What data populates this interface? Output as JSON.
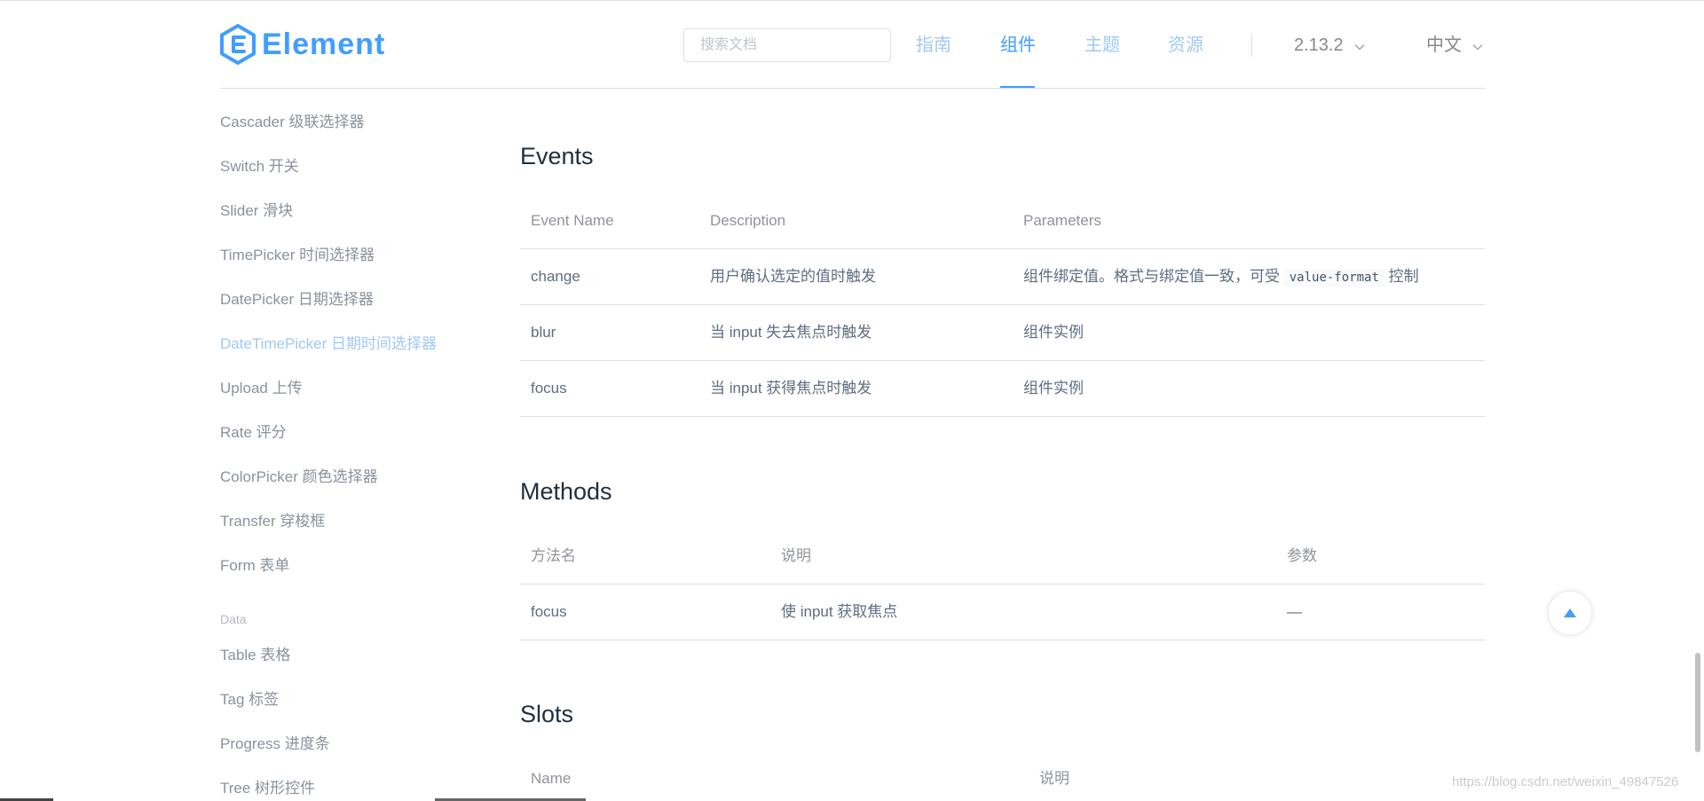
{
  "header": {
    "logo_text": "Element",
    "search_placeholder": "搜索文档",
    "nav": [
      {
        "label": "指南",
        "active": false
      },
      {
        "label": "组件",
        "active": true
      },
      {
        "label": "主题",
        "active": false
      },
      {
        "label": "资源",
        "active": false
      }
    ],
    "version": "2.13.2",
    "language": "中文"
  },
  "sidebar": {
    "items": [
      {
        "label": "Cascader 级联选择器"
      },
      {
        "label": "Switch 开关"
      },
      {
        "label": "Slider 滑块"
      },
      {
        "label": "TimePicker 时间选择器"
      },
      {
        "label": "DatePicker 日期选择器"
      },
      {
        "label": "DateTimePicker 日期时间选择器",
        "active": true
      },
      {
        "label": "Upload 上传"
      },
      {
        "label": "Rate 评分"
      },
      {
        "label": "ColorPicker 颜色选择器"
      },
      {
        "label": "Transfer 穿梭框"
      },
      {
        "label": "Form 表单"
      }
    ],
    "group_label": "Data",
    "group_items": [
      {
        "label": "Table 表格"
      },
      {
        "label": "Tag 标签"
      },
      {
        "label": "Progress 进度条"
      },
      {
        "label": "Tree 树形控件"
      }
    ]
  },
  "events": {
    "title": "Events",
    "headers": [
      "Event Name",
      "Description",
      "Parameters"
    ],
    "rows": [
      {
        "name": "change",
        "desc": "用户确认选定的值时触发",
        "params_pre": "组件绑定值。格式与绑定值一致，可受",
        "params_code": "value-format",
        "params_post": "控制"
      },
      {
        "name": "blur",
        "desc": "当 input 失去焦点时触发",
        "params_pre": "组件实例"
      },
      {
        "name": "focus",
        "desc": "当 input 获得焦点时触发",
        "params_pre": "组件实例"
      }
    ]
  },
  "methods": {
    "title": "Methods",
    "headers": [
      "方法名",
      "说明",
      "参数"
    ],
    "rows": [
      {
        "name": "focus",
        "desc": "使 input 获取焦点",
        "params": "—"
      }
    ]
  },
  "slots": {
    "title": "Slots",
    "headers": [
      "Name",
      "说明"
    ]
  },
  "watermark": "https://blog.csdn.net/weixin_49847526",
  "colors": {
    "accent": "#409eff",
    "accent_light": "#9fc9f3",
    "text": "#5e6d82",
    "heading": "#1f2f3d",
    "border": "#dcdfe6"
  },
  "icons": {
    "logo": "element-logo-icon",
    "version_chevron": "chevron-down-icon",
    "language_chevron": "chevron-down-icon",
    "backtop": "caret-up-icon"
  }
}
